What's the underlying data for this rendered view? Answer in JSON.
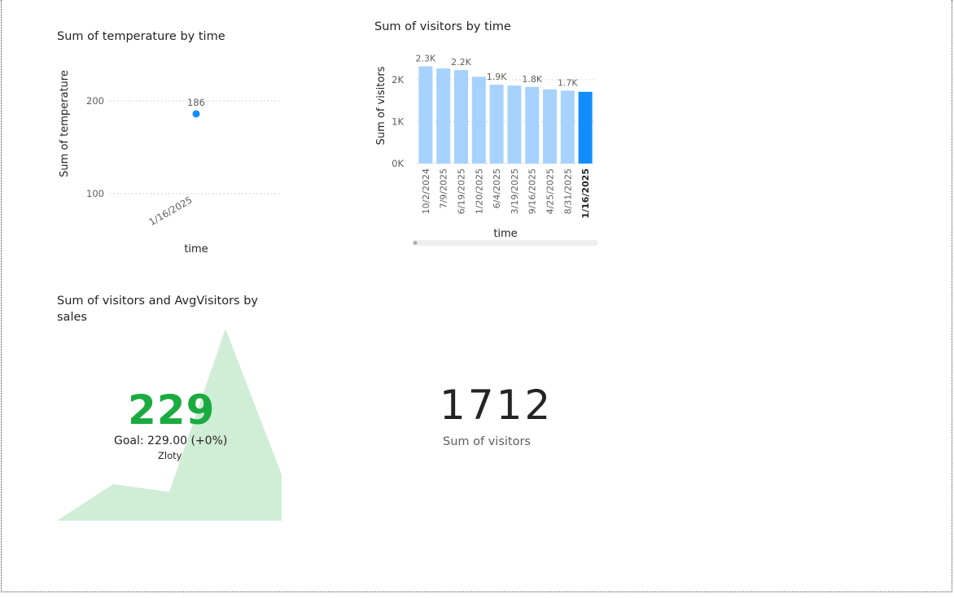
{
  "scatter": {
    "chart_data": {
      "type": "scatter",
      "title": "Sum of temperature by time",
      "xlabel": "time",
      "ylabel": "Sum of temperature",
      "categories": [
        "1/16/2025"
      ],
      "values": [
        186
      ],
      "data_labels": [
        "186"
      ],
      "yticks": [
        {
          "value": 100,
          "label": "100"
        },
        {
          "value": 200,
          "label": "200"
        }
      ],
      "ylim": [
        100,
        200
      ],
      "grid": true,
      "color": "#118dff"
    }
  },
  "bars": {
    "chart_data": {
      "type": "bar",
      "title": "Sum of visitors by time",
      "xlabel": "time",
      "ylabel": "Sum of visitors",
      "categories": [
        "10/2/2024",
        "7/9/2025",
        "6/19/2025",
        "1/20/2025",
        "6/4/2025",
        "3/19/2025",
        "9/16/2025",
        "4/25/2025",
        "8/31/2025",
        "1/16/2025"
      ],
      "values": [
        2320,
        2270,
        2230,
        2070,
        1880,
        1860,
        1830,
        1770,
        1740,
        1712
      ],
      "data_labels": [
        "2.3K",
        "",
        "2.2K",
        "",
        "1.9K",
        "",
        "1.8K",
        "",
        "1.7K",
        ""
      ],
      "yticks": [
        {
          "value": 0,
          "label": "0K"
        },
        {
          "value": 1000,
          "label": "1K"
        },
        {
          "value": 2000,
          "label": "2K"
        }
      ],
      "ylim": [
        0,
        2330
      ],
      "highlight_index": 9,
      "colors": {
        "bar": "#a6d2fd",
        "highlight": "#118dff"
      }
    }
  },
  "kpi": {
    "chart_data": {
      "type": "area",
      "title": "Sum of visitors and AvgVisitors by sales",
      "values": [
        0,
        0.19,
        0.15,
        1.0,
        0.24
      ],
      "color": "#d0edd6"
    },
    "value": "229",
    "goal_text": "Goal: 229.00 (+0%)",
    "unit": "Zloty",
    "status_color": "#1aab40"
  },
  "card": {
    "value": "1712",
    "label": "Sum of visitors"
  }
}
